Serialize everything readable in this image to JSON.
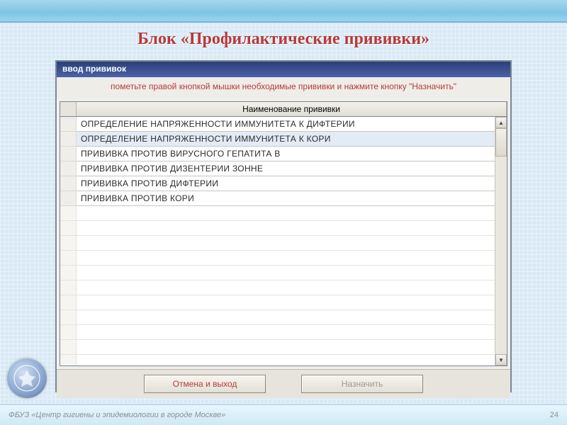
{
  "slide": {
    "title": "Блок «Профилактические прививки»",
    "footer": "ФБУЗ «Центр гигиены и эпидемиологии в городе Москве»",
    "page": "24"
  },
  "dialog": {
    "title": "ввод прививок",
    "help": "пометьте правой кнопкой мышки необходимые прививки и нажмите кнопку \"Назначить\"",
    "column_header": "Наименование прививки",
    "rows": [
      "ОПРЕДЕЛЕНИЕ НАПРЯЖЕННОСТИ ИММУНИТЕТА К ДИФТЕРИИ",
      "ОПРЕДЕЛЕНИЕ НАПРЯЖЕННОСТИ ИММУНИТЕТА К КОРИ",
      "ПРИВИВКА ПРОТИВ ВИРУСНОГО ГЕПАТИТА В",
      "ПРИВИВКА ПРОТИВ ДИЗЕНТЕРИИ ЗОННЕ",
      "ПРИВИВКА ПРОТИВ ДИФТЕРИИ",
      "ПРИВИВКА ПРОТИВ КОРИ"
    ],
    "selected_index": 1,
    "buttons": {
      "cancel": "Отмена и выход",
      "assign": "Назначить"
    }
  }
}
